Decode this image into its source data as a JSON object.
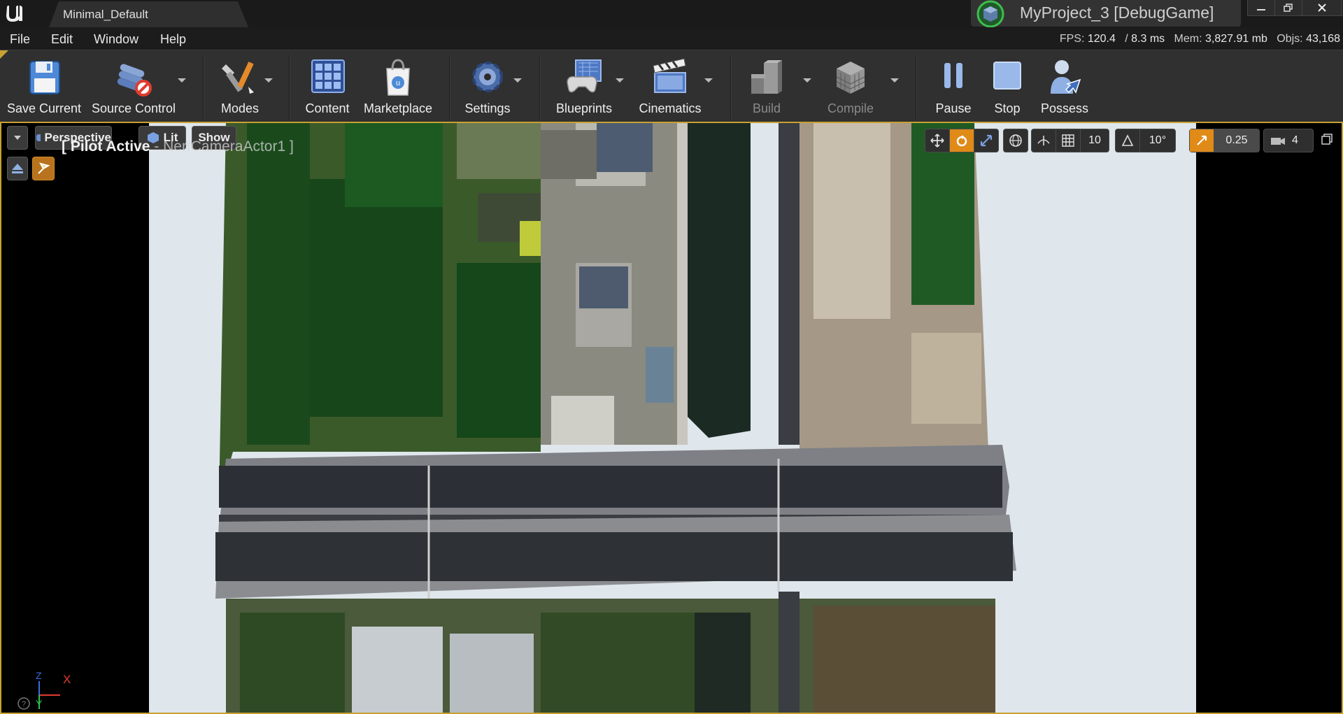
{
  "window": {
    "tab_title": "Minimal_Default",
    "project_title": "MyProject_3 [DebugGame]"
  },
  "menu": {
    "items": [
      "File",
      "Edit",
      "Window",
      "Help"
    ]
  },
  "stats": {
    "fps_label": "FPS:",
    "fps": "120.4",
    "frame_sep": "/",
    "frame_ms": "8.3 ms",
    "mem_label": "Mem:",
    "mem": "3,827.91 mb",
    "objs_label": "Objs:",
    "objs": "43,168"
  },
  "toolbar": {
    "save_current": "Save Current",
    "source_control": "Source Control",
    "modes": "Modes",
    "content": "Content",
    "marketplace": "Marketplace",
    "settings": "Settings",
    "blueprints": "Blueprints",
    "cinematics": "Cinematics",
    "build": "Build",
    "compile": "Compile",
    "pause": "Pause",
    "stop": "Stop",
    "possess": "Possess"
  },
  "viewport": {
    "view_mode": "Perspective",
    "lighting": "Lit",
    "show": "Show",
    "pilot_label": "[ Pilot Active",
    "pilot_actor": "- NerfCameraActor1 ]",
    "grid_snap": "10",
    "rotation_snap": "10°",
    "scale_snap": "0.25",
    "camera_speed": "4",
    "axis_x": "X",
    "axis_y": "Y",
    "axis_z": "Z"
  },
  "colors": {
    "accent": "#c8a132",
    "toolbar_bg": "#303030",
    "menubar_bg": "#1c1c1c",
    "active_orange": "#e08a18"
  }
}
